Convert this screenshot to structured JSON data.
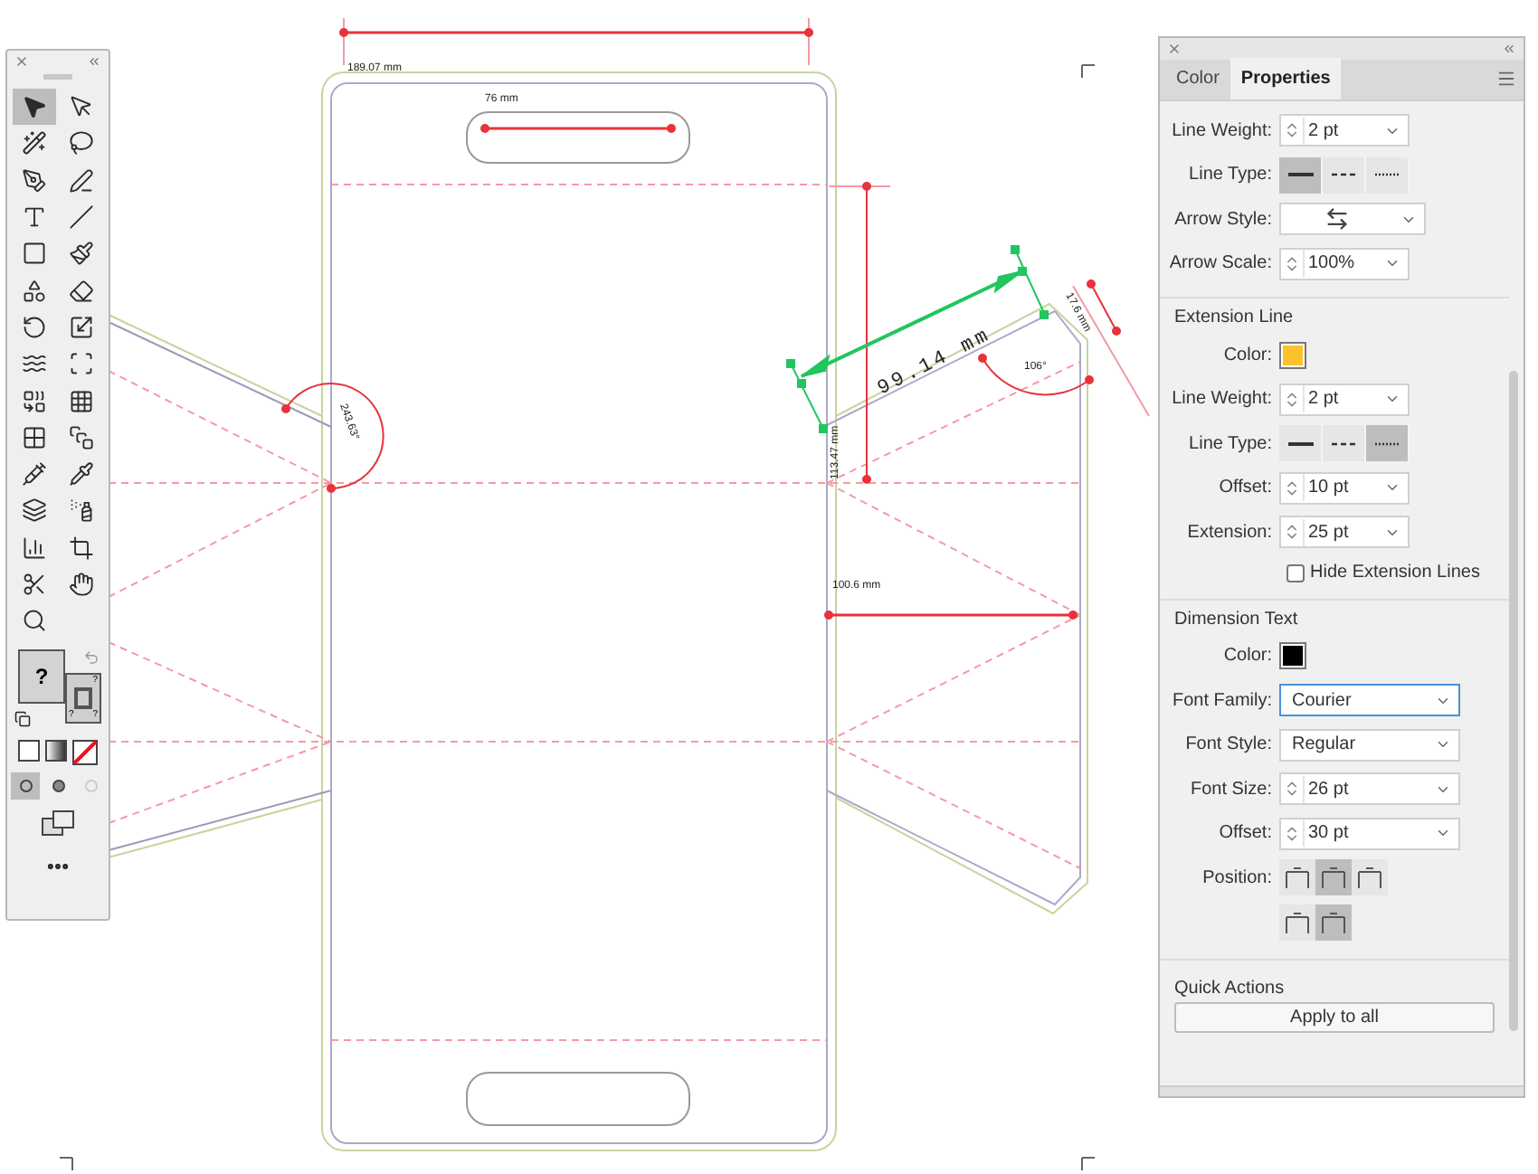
{
  "canvas": {
    "labels": [
      {
        "text": "189.07 mm"
      },
      {
        "text": "76 mm"
      },
      {
        "text": "113.47 mm"
      },
      {
        "text": "100.6 mm"
      },
      {
        "text": "99.14 mm"
      },
      {
        "text": "17.6 mm"
      },
      {
        "text": "106°"
      },
      {
        "text": "243.63°"
      }
    ]
  },
  "toolbar": {
    "tools": [
      {
        "selected": true
      },
      {
        "selected": false
      },
      {
        "selected": false
      },
      {
        "selected": false
      },
      {
        "selected": false
      },
      {
        "selected": false
      },
      {
        "selected": false
      },
      {
        "selected": false
      },
      {
        "selected": false
      },
      {
        "selected": false
      },
      {
        "selected": false
      },
      {
        "selected": false
      },
      {
        "selected": false
      },
      {
        "selected": false
      },
      {
        "selected": false
      },
      {
        "selected": false
      },
      {
        "selected": false
      },
      {
        "selected": false
      },
      {
        "selected": false
      },
      {
        "selected": false
      },
      {
        "selected": false
      },
      {
        "selected": false
      },
      {
        "selected": false
      },
      {
        "selected": false
      },
      {
        "selected": false
      },
      {
        "selected": false
      },
      {
        "selected": false
      },
      {
        "selected": false
      },
      {
        "selected": false
      }
    ],
    "fill_mark": "?",
    "stroke_marks": [
      "?",
      "?",
      "?"
    ]
  },
  "panel": {
    "tabs": [
      {
        "label": "Color",
        "selected": false
      },
      {
        "label": "Properties",
        "selected": true
      }
    ],
    "dimension_line": {
      "line_weight": {
        "label": "Line Weight:",
        "value": "2 pt"
      },
      "line_type": {
        "label": "Line Type:",
        "options": [
          {
            "kind": "solid",
            "selected": true
          },
          {
            "kind": "dashed",
            "selected": false
          },
          {
            "kind": "dotted",
            "selected": false
          }
        ]
      },
      "arrow_style": {
        "label": "Arrow Style:"
      },
      "arrow_scale": {
        "label": "Arrow Scale:",
        "value": "100%"
      }
    },
    "extension_line": {
      "title": "Extension Line",
      "color": {
        "label": "Color:",
        "color": "#fcc12d"
      },
      "line_weight": {
        "label": "Line Weight:",
        "value": "2 pt"
      },
      "line_type": {
        "label": "Line Type:",
        "options": [
          {
            "kind": "solid",
            "selected": false
          },
          {
            "kind": "dashed",
            "selected": false
          },
          {
            "kind": "dotted",
            "selected": true
          }
        ]
      },
      "offset": {
        "label": "Offset:",
        "value": "10 pt"
      },
      "extension": {
        "label": "Extension:",
        "value": "25 pt"
      },
      "hide_lines": {
        "label": "Hide Extension Lines",
        "checked": false
      }
    },
    "dimension_text": {
      "title": "Dimension Text",
      "color": {
        "label": "Color:",
        "color": "#000000"
      },
      "font_family": {
        "label": "Font Family:",
        "value": "Courier",
        "focused": true
      },
      "font_style": {
        "label": "Font Style:",
        "value": "Regular"
      },
      "font_size": {
        "label": "Font Size:",
        "value": "26 pt"
      },
      "offset": {
        "label": "Offset:",
        "value": "30 pt"
      },
      "position": {
        "label": "Position:",
        "options": [
          {
            "selected": false
          },
          {
            "selected": true
          },
          {
            "selected": false
          },
          {
            "selected": false
          },
          {
            "selected": true
          }
        ]
      }
    },
    "quick_actions": {
      "title": "Quick Actions",
      "button": "Apply to all"
    }
  }
}
